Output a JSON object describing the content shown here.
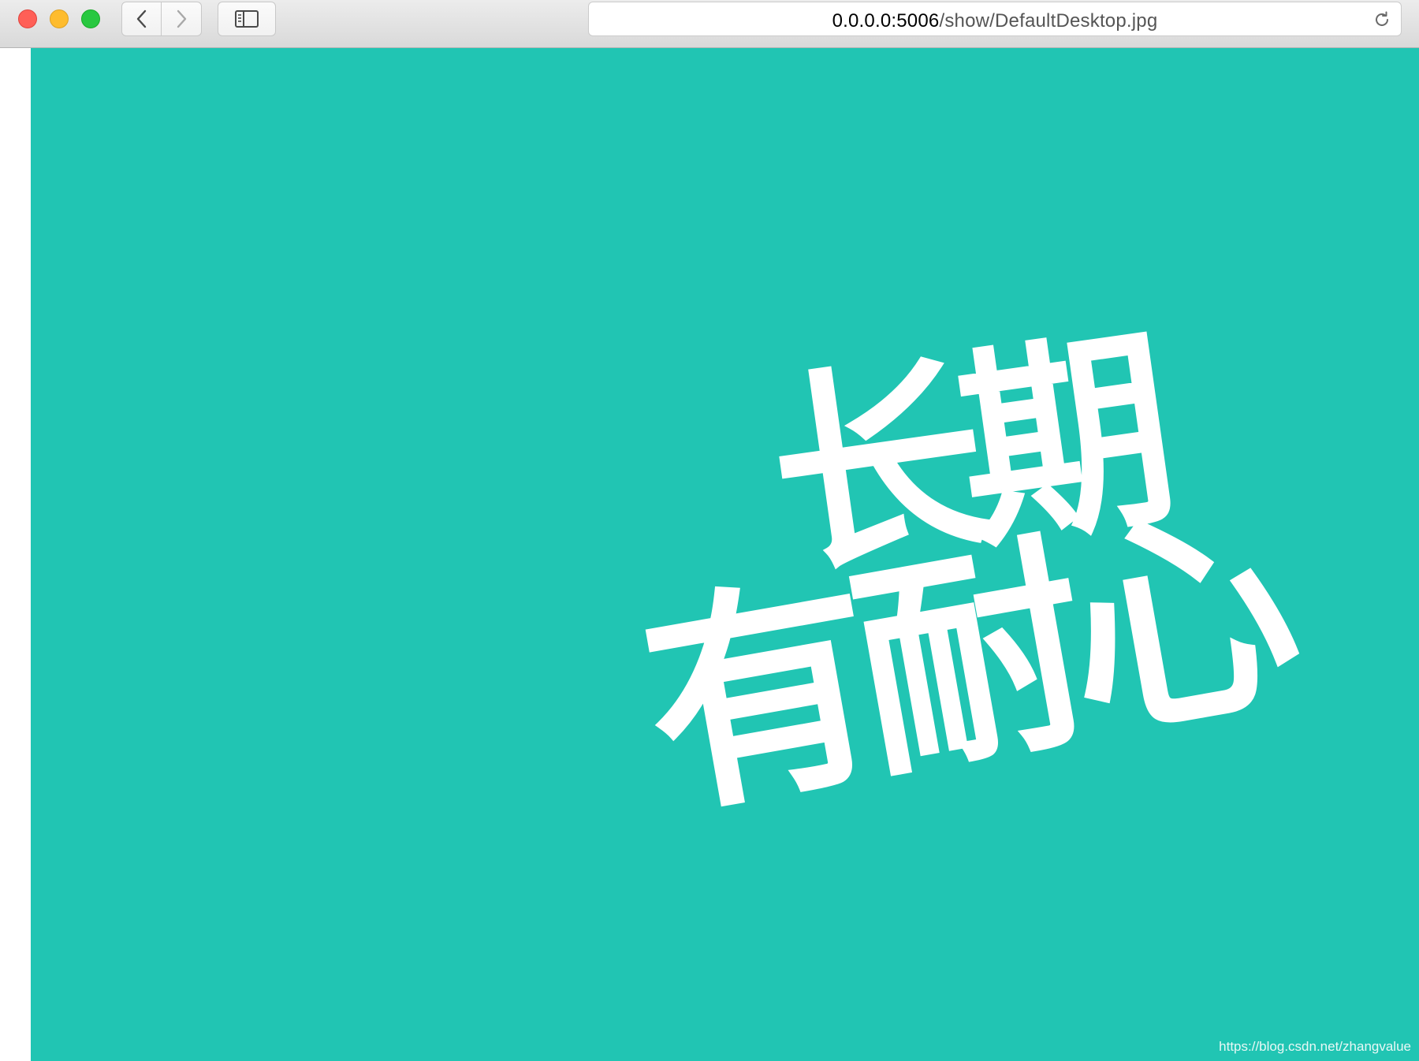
{
  "browser": {
    "window_controls": {
      "close_color": "#ff5f57",
      "minimize_color": "#febc2e",
      "zoom_color": "#28c840"
    },
    "toolbar": {
      "back_icon": "chevron-left-icon",
      "forward_icon": "chevron-right-icon",
      "sidebar_icon": "sidebar-icon",
      "reload_icon": "reload-icon"
    },
    "address_bar": {
      "host": "0.0.0.0:5006",
      "path": "/show/DefaultDesktop.jpg"
    }
  },
  "content": {
    "background_color": "#21c5b3",
    "calligraphy_line1": "长期",
    "calligraphy_line2": "有耐心",
    "text_color": "#ffffff",
    "watermark": "https://blog.csdn.net/zhangvalue"
  }
}
